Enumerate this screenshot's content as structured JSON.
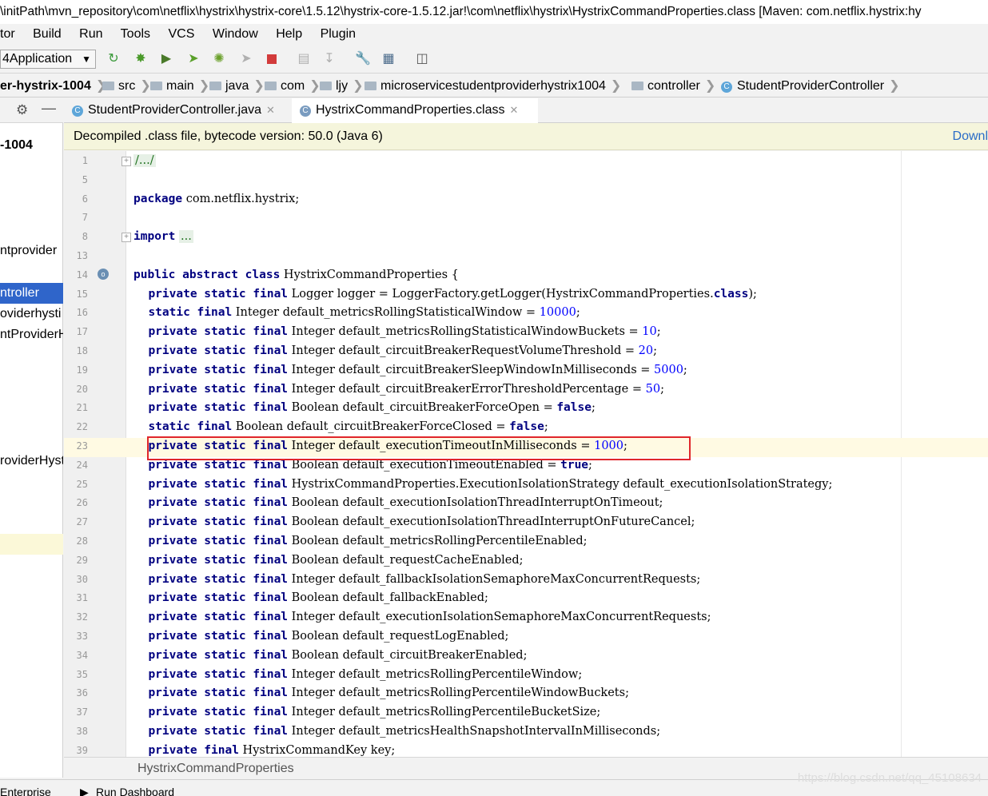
{
  "window": {
    "title": "\\initPath\\mvn_repository\\com\\netflix\\hystrix\\hystrix-core\\1.5.12\\hystrix-core-1.5.12.jar!\\com\\netflix\\hystrix\\HystrixCommandProperties.class [Maven: com.netflix.hystrix:hy"
  },
  "menu": {
    "items": [
      {
        "label": "tor"
      },
      {
        "label": "Build"
      },
      {
        "label": "Run"
      },
      {
        "label": "Tools"
      },
      {
        "label": "VCS"
      },
      {
        "label": "Window"
      },
      {
        "label": "Help"
      },
      {
        "label": "Plugin"
      }
    ]
  },
  "toolbar": {
    "run_config": "4Application",
    "icons": [
      "rerun-icon",
      "debug-icon",
      "coverage-icon",
      "run-jrebel-icon",
      "debug-jrebel-icon",
      "build-icon",
      "stop-icon",
      "project-structure-icon",
      "download-icon",
      "settings-wrench-icon",
      "sdk-icon",
      "layout-icon"
    ]
  },
  "breadcrumb": {
    "items": [
      {
        "label": "er-hystrix-1004",
        "icon": "module"
      },
      {
        "label": "src",
        "icon": "folder"
      },
      {
        "label": "main",
        "icon": "folder"
      },
      {
        "label": "java",
        "icon": "folder"
      },
      {
        "label": "com",
        "icon": "folder"
      },
      {
        "label": "ljy",
        "icon": "folder"
      },
      {
        "label": "microservicestudentproviderhystrix1004",
        "icon": "folder"
      },
      {
        "label": "controller",
        "icon": "folder"
      },
      {
        "label": "StudentProviderController",
        "icon": "class"
      }
    ]
  },
  "project_panel": {
    "items": [
      {
        "label": "-1004",
        "bold": true
      },
      {
        "label": "ntprovider",
        "bold": false
      },
      {
        "label": "ntroller",
        "bold": false,
        "selected": true
      },
      {
        "label": "oviderhysti",
        "bold": false
      },
      {
        "label": "ntProviderH",
        "bold": false
      },
      {
        "label": "roviderHyst",
        "bold": false
      }
    ]
  },
  "tabs": [
    {
      "label": "StudentProviderController.java",
      "active": false
    },
    {
      "label": "HystrixCommandProperties.class",
      "active": true
    }
  ],
  "banner": {
    "text": "Decompiled .class file, bytecode version: 50.0 (Java 6)",
    "action": "Downl"
  },
  "editor": {
    "lines": [
      {
        "n": "1",
        "html": "<span class='folded'>/.../</span>",
        "fold": "+"
      },
      {
        "n": "5",
        "html": ""
      },
      {
        "n": "6",
        "html": "<span class='kw'>package</span> com.netflix.hystrix;"
      },
      {
        "n": "7",
        "html": ""
      },
      {
        "n": "8",
        "html": "<span class='kw'>import</span> <span class='folded'>...</span>",
        "fold": "+"
      },
      {
        "n": "13",
        "html": ""
      },
      {
        "n": "14",
        "html": "<span class='kw'>public abstract class</span> HystrixCommandProperties {"
      },
      {
        "n": "15",
        "html": "    <span class='kw'>private static final</span> Logger logger = LoggerFactory.getLogger(HystrixCommandProperties.<span class='kw'>class</span>);"
      },
      {
        "n": "16",
        "html": "    <span class='kw'>static final</span> Integer default_metricsRollingStatisticalWindow = <span class='num'>10000</span>;"
      },
      {
        "n": "17",
        "html": "    <span class='kw'>private static final</span> Integer default_metricsRollingStatisticalWindowBuckets = <span class='num'>10</span>;"
      },
      {
        "n": "18",
        "html": "    <span class='kw'>private static final</span> Integer default_circuitBreakerRequestVolumeThreshold = <span class='num'>20</span>;"
      },
      {
        "n": "19",
        "html": "    <span class='kw'>private static final</span> Integer default_circuitBreakerSleepWindowInMilliseconds = <span class='num'>5000</span>;"
      },
      {
        "n": "20",
        "html": "    <span class='kw'>private static final</span> Integer default_circuitBreakerErrorThresholdPercentage = <span class='num'>50</span>;"
      },
      {
        "n": "21",
        "html": "    <span class='kw'>private static final</span> Boolean default_circuitBreakerForceOpen = <span class='kw'>false</span>;"
      },
      {
        "n": "22",
        "html": "    <span class='kw'>static final</span> Boolean default_circuitBreakerForceClosed = <span class='kw'>false</span>;"
      },
      {
        "n": "23",
        "html": "    <span class='kw'>private static final</span> Integer default_executionTimeoutInMilliseconds = <span class='num'>1000</span>;",
        "current": true
      },
      {
        "n": "24",
        "html": "    <span class='kw'>private static final</span> Boolean default_executionTimeoutEnabled = <span class='kw'>true</span>;"
      },
      {
        "n": "25",
        "html": "    <span class='kw'>private static final</span> HystrixCommandProperties.ExecutionIsolationStrategy default_executionIsolationStrategy;"
      },
      {
        "n": "26",
        "html": "    <span class='kw'>private static final</span> Boolean default_executionIsolationThreadInterruptOnTimeout;"
      },
      {
        "n": "27",
        "html": "    <span class='kw'>private static final</span> Boolean default_executionIsolationThreadInterruptOnFutureCancel;"
      },
      {
        "n": "28",
        "html": "    <span class='kw'>private static final</span> Boolean default_metricsRollingPercentileEnabled;"
      },
      {
        "n": "29",
        "html": "    <span class='kw'>private static final</span> Boolean default_requestCacheEnabled;"
      },
      {
        "n": "30",
        "html": "    <span class='kw'>private static final</span> Integer default_fallbackIsolationSemaphoreMaxConcurrentRequests;"
      },
      {
        "n": "31",
        "html": "    <span class='kw'>private static final</span> Boolean default_fallbackEnabled;"
      },
      {
        "n": "32",
        "html": "    <span class='kw'>private static final</span> Integer default_executionIsolationSemaphoreMaxConcurrentRequests;"
      },
      {
        "n": "33",
        "html": "    <span class='kw'>private static final</span> Boolean default_requestLogEnabled;"
      },
      {
        "n": "34",
        "html": "    <span class='kw'>private static final</span> Boolean default_circuitBreakerEnabled;"
      },
      {
        "n": "35",
        "html": "    <span class='kw'>private static final</span> Integer default_metricsRollingPercentileWindow;"
      },
      {
        "n": "36",
        "html": "    <span class='kw'>private static final</span> Integer default_metricsRollingPercentileWindowBuckets;"
      },
      {
        "n": "37",
        "html": "    <span class='kw'>private static final</span> Integer default_metricsRollingPercentileBucketSize;"
      },
      {
        "n": "38",
        "html": "    <span class='kw'>private static final</span> Integer default_metricsHealthSnapshotIntervalInMilliseconds;"
      },
      {
        "n": "39",
        "html": "    <span class='kw'>private final</span> HystrixCommandKey key;"
      }
    ]
  },
  "structure_bar": {
    "text": "HystrixCommandProperties"
  },
  "bottom_bar": {
    "items": [
      {
        "label": "Enterprise"
      },
      {
        "label": "Run Dashboard"
      }
    ]
  },
  "watermark": "https://blog.csdn.net/qq_45108634",
  "colors": {
    "keyword": "#000080",
    "number": "#0000ff",
    "highlight_box": "#e0262b",
    "banner_bg": "#f5f5dc",
    "link": "#2a6cc7"
  }
}
